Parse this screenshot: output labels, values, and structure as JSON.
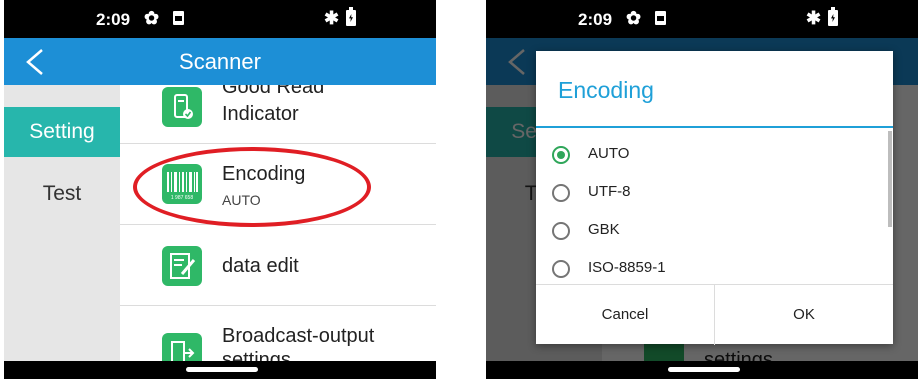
{
  "status": {
    "time": "2:09"
  },
  "app": {
    "title": "Scanner"
  },
  "tabs": [
    {
      "label": "Setting"
    },
    {
      "label": "Test"
    }
  ],
  "list": [
    {
      "title_line1": "Good Read",
      "title_line2": "Indicator",
      "icon": "indicator-icon"
    },
    {
      "title": "Encoding",
      "subtitle": "AUTO",
      "icon": "barcode-icon",
      "barcode_digits": "1 987 658"
    },
    {
      "title": "data edit",
      "icon": "edit-icon"
    },
    {
      "title_line1": "Broadcast-output",
      "title_line2": "settings",
      "icon": "broadcast-icon"
    }
  ],
  "dialog": {
    "title": "Encoding",
    "options": [
      {
        "label": "AUTO",
        "selected": true
      },
      {
        "label": "UTF-8",
        "selected": false
      },
      {
        "label": "GBK",
        "selected": false
      },
      {
        "label": "ISO-8859-1",
        "selected": false
      }
    ],
    "cancel_label": "Cancel",
    "ok_label": "OK"
  },
  "colors": {
    "appbar": "#1d8fd6",
    "tab_active": "#27b6ac",
    "icon_green": "#2fb867",
    "highlight_oval": "#e01e24",
    "dialog_accent": "#1fa0d8",
    "radio_selected": "#2fa65a"
  }
}
